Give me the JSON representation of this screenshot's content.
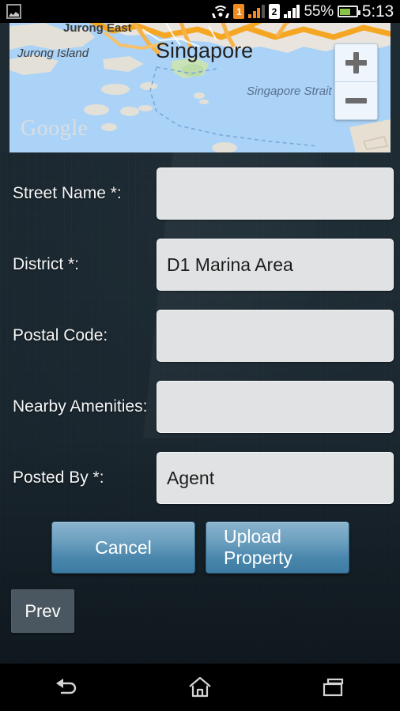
{
  "status_bar": {
    "notification_icon": "photo-icon",
    "wifi_icon": "wifi-icon",
    "sim1_label": "1",
    "sim2_label": "2",
    "battery_percent": "55%",
    "battery_level": 55,
    "time": "5:13"
  },
  "map": {
    "provider_watermark": "Google",
    "labels": {
      "jurong_east": "Jurong East",
      "jurong_island": "Jurong Island",
      "singapore": "Singapore",
      "singapore_strait": "Singapore Strait"
    },
    "zoom_in_label": "+",
    "zoom_out_label": "−",
    "colors": {
      "water": "#aad3f7",
      "land": "#e8e4dd",
      "highway": "#f5a623",
      "park": "#c5e0b4"
    }
  },
  "form": {
    "fields": [
      {
        "label": "Street Name *:",
        "value": "",
        "placeholder": "",
        "required": true
      },
      {
        "label": "District *:",
        "value": "D1 Marina Area",
        "placeholder": "",
        "required": true
      },
      {
        "label": "Postal Code:",
        "value": "",
        "placeholder": "",
        "required": false
      },
      {
        "label": "Nearby Amenities:",
        "value": "",
        "placeholder": "",
        "required": false
      },
      {
        "label": "Posted By *:",
        "value": "Agent",
        "placeholder": "",
        "required": true
      }
    ]
  },
  "actions": {
    "cancel_label": "Cancel",
    "upload_label": "Upload Property",
    "prev_label": "Prev"
  },
  "nav_bar": {
    "back_icon": "back-arrow-icon",
    "home_icon": "home-icon",
    "recents_icon": "recent-apps-icon"
  },
  "theme": {
    "background": "#1e2b33",
    "input_background": "#e0e2e3",
    "button_blue_top": "#8ab3cd",
    "button_blue_bottom": "#3d7ba3",
    "prev_button": "#4a5760",
    "text_light": "#f4f6f7"
  }
}
